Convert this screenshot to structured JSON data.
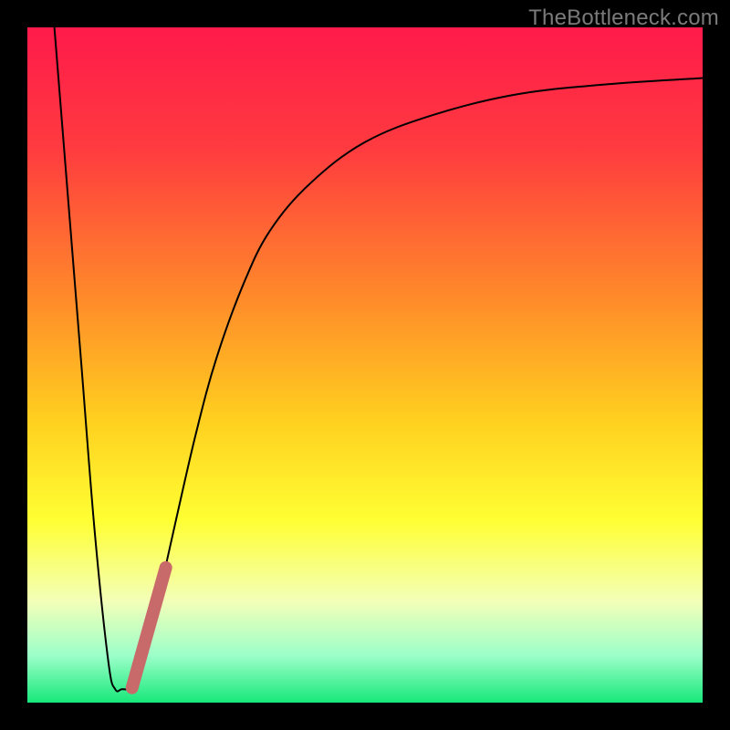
{
  "watermark": "TheBottleneck.com",
  "chart_data": {
    "type": "line",
    "title": "",
    "xlabel": "",
    "ylabel": "",
    "xlim": [
      0,
      100
    ],
    "ylim": [
      0,
      100
    ],
    "gradient_stops": [
      {
        "offset": 0.0,
        "color": "#ff1a4b"
      },
      {
        "offset": 0.18,
        "color": "#ff3b3f"
      },
      {
        "offset": 0.4,
        "color": "#ff8a2a"
      },
      {
        "offset": 0.58,
        "color": "#ffcf1f"
      },
      {
        "offset": 0.73,
        "color": "#ffff33"
      },
      {
        "offset": 0.85,
        "color": "#f3ffb8"
      },
      {
        "offset": 0.93,
        "color": "#9cffc9"
      },
      {
        "offset": 1.0,
        "color": "#17e87a"
      }
    ],
    "series": [
      {
        "name": "curve",
        "stroke": "#000000",
        "stroke_width": 2,
        "points": [
          {
            "x": 4,
            "y": 100
          },
          {
            "x": 6,
            "y": 75
          },
          {
            "x": 8,
            "y": 50
          },
          {
            "x": 10,
            "y": 25
          },
          {
            "x": 12,
            "y": 6
          },
          {
            "x": 13,
            "y": 2
          },
          {
            "x": 14,
            "y": 2
          },
          {
            "x": 15,
            "y": 2
          },
          {
            "x": 16,
            "y": 2.5
          },
          {
            "x": 17,
            "y": 5
          },
          {
            "x": 18,
            "y": 9
          },
          {
            "x": 20,
            "y": 18
          },
          {
            "x": 22,
            "y": 27
          },
          {
            "x": 25,
            "y": 40
          },
          {
            "x": 28,
            "y": 51
          },
          {
            "x": 32,
            "y": 62
          },
          {
            "x": 36,
            "y": 70
          },
          {
            "x": 42,
            "y": 77
          },
          {
            "x": 50,
            "y": 83
          },
          {
            "x": 60,
            "y": 87
          },
          {
            "x": 72,
            "y": 90
          },
          {
            "x": 85,
            "y": 91.5
          },
          {
            "x": 100,
            "y": 92.5
          }
        ]
      },
      {
        "name": "highlight",
        "stroke": "#c96a6a",
        "stroke_width": 14,
        "linecap": "round",
        "points": [
          {
            "x": 15.5,
            "y": 2.2
          },
          {
            "x": 20.5,
            "y": 20
          }
        ]
      }
    ]
  }
}
